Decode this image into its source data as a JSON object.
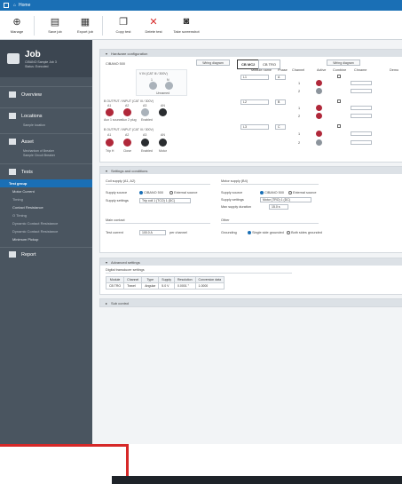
{
  "titlebar": {
    "title": "Home"
  },
  "toolbar": {
    "buttons": [
      {
        "label": "Manage"
      },
      {
        "label": "Save job"
      },
      {
        "label": "Export job"
      },
      {
        "label": "Copy test"
      },
      {
        "label": "Delete test"
      },
      {
        "label": "Take screenshot"
      }
    ]
  },
  "sidebar": {
    "job": {
      "title": "Job",
      "subtitle": "CIBANO Sample Job 3",
      "status": "Status: Executed"
    },
    "sections": [
      {
        "label": "Overview"
      },
      {
        "label": "Locations",
        "sub": "Sample location"
      },
      {
        "label": "Asset",
        "sub": "Mechanism of Breaker",
        "sub2": "Sample Circuit Breaker"
      },
      {
        "label": "Tests"
      }
    ],
    "tests": [
      "Test group",
      "Motor Current",
      "Timing",
      "Contact Resistance",
      "O Timing",
      "Dynamic Contact Resistance",
      "Dynamic Contact Resistance",
      "Minimum Pickup"
    ],
    "report": "Report"
  },
  "hardware": {
    "header": "Hardware configuration",
    "device": "CIBANO 500",
    "wiring_left": "Wiring diagram",
    "wiring_right": "Wiring diagram",
    "tabs": [
      "CB MC2",
      "CB TRO"
    ],
    "group1": {
      "title": "V IN (CAT III / 300V)",
      "labels": [
        "1",
        "N",
        "Unnamed"
      ]
    },
    "group2": {
      "title": "B OUTPUT / INPUT (CAT III / 300V)",
      "labels": [
        "A1",
        "A2",
        "A3",
        "AN"
      ],
      "sub": [
        "Aux 1 source",
        "Aux 2 plug",
        "Enabled"
      ]
    },
    "group3": {
      "title": "B OUTPUT / INPUT (CAT III / 300V)",
      "labels": [
        "A1",
        "A2",
        "A3",
        "AN"
      ],
      "sub": [
        "Trip H",
        "Close",
        "Enabled",
        "Motor"
      ]
    },
    "columns": [
      "Module name",
      "Phase",
      "Channel",
      "Active",
      "Combine",
      "Chname",
      "Demo"
    ],
    "modules": [
      {
        "name": "L1",
        "phase": "A",
        "rows": [
          "1",
          "2"
        ]
      },
      {
        "name": "L2",
        "phase": "B",
        "rows": [
          "1",
          "2"
        ]
      },
      {
        "name": "L3",
        "phase": "C",
        "rows": [
          "1",
          "2"
        ]
      }
    ]
  },
  "settings": {
    "header": "Settings and conditions",
    "coil_title": "Coil supply (A1, A2)",
    "coil_source": "Supply source",
    "coil_opt1": "CIBANO 500",
    "coil_opt2": "External source",
    "coil_settings": "Supply settings",
    "coil_value": "Trip coil 1 (TCO) 1 (DC)",
    "motor_title": "Motor supply (B4)",
    "motor_source": "Supply source",
    "motor_opt1": "CIBANO 500",
    "motor_opt2": "External source",
    "motor_settings": "Supply settings",
    "motor_value": "Motor (TRO) 1 (DC)",
    "max_supply": "Max supply duration",
    "max_value": "15.0 s",
    "main_contact": "Main contact",
    "test_current": "Test current",
    "test_value": "100.0 A",
    "per_channel": "per channel",
    "other": "Other",
    "grounding": "Grounding",
    "ground_opt1": "Single side grounded",
    "ground_opt2": "Both sides grounded"
  },
  "advanced": {
    "header": "Advanced settings",
    "table_title": "Digital transducer settings",
    "cols": [
      "Module",
      "Channel",
      "Type",
      "Supply",
      "Resolution",
      "Conversion data"
    ],
    "row": [
      "CB TRO",
      "Travel",
      "Angular",
      "5.0 V",
      "0.0001 °",
      "1.0000"
    ]
  },
  "sections": {
    "sub_control": "Sub control"
  }
}
